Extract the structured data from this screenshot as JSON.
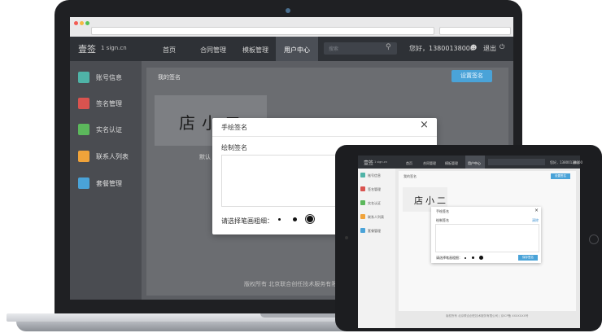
{
  "desktop": {
    "logo": "壹签",
    "logo_sub": "1 sign.cn",
    "nav": [
      "首页",
      "合同管理",
      "模板管理",
      "用户中心"
    ],
    "search_placeholder": "搜索",
    "greeting": "您好，13800138000",
    "logout": "退出",
    "sidebar": [
      {
        "label": "账号信息",
        "color": "#4fb3a7"
      },
      {
        "label": "签名管理",
        "color": "#d9534f"
      },
      {
        "label": "实名认证",
        "color": "#5cb85c"
      },
      {
        "label": "联系人列表",
        "color": "#f0a33a"
      },
      {
        "label": "套餐管理",
        "color": "#4aa3d8"
      }
    ],
    "page_title": "我的签名",
    "set_signature": "设置签名",
    "signature_text": "店小二",
    "default_label": "默认",
    "footer": "版权所有 北京联合创任技术服务有限"
  },
  "modal": {
    "title": "手绘签名",
    "close": "×",
    "draw_label": "绘制签名",
    "brush_label": "请选择笔画粗细："
  },
  "tablet": {
    "logo": "壹签",
    "logo_sub": "1 sign.cn",
    "nav": [
      "首页",
      "合同管理",
      "模板管理",
      "用户中心"
    ],
    "greeting": "您好，13800138000",
    "logout": "退出",
    "sidebar": [
      "账号信息",
      "签名管理",
      "实名认证",
      "联系人列表",
      "套餐管理"
    ],
    "page_title": "我的签名",
    "set_signature": "设置签名",
    "signature_text": "店小二",
    "modal_title": "手绘签名",
    "draw_label": "绘制签名",
    "clear": "清除",
    "brush_label": "请选择笔画粗细：",
    "save": "保存签名",
    "footer": "版权所有 北京联合创任技术服务有限公司 | 京ICP备 XXXXXXX号"
  },
  "colors": {
    "accent": "#4aa3d8",
    "nav_bg": "#2e3136"
  }
}
